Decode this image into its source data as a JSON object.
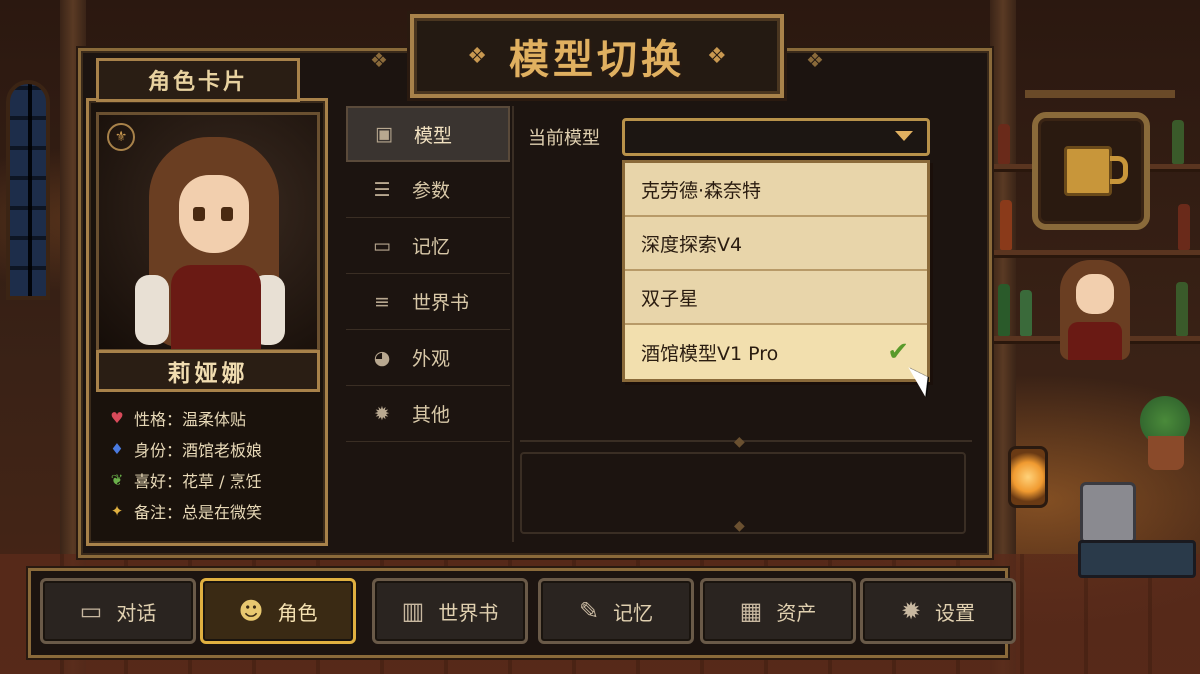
{
  "app": {
    "title": "模型切换"
  },
  "card": {
    "title": "角色卡片",
    "name": "莉娅娜",
    "traits": [
      {
        "icon": "heart-icon",
        "glyph": "♥",
        "color": "#d84a5a",
        "text": "性格：温柔体贴"
      },
      {
        "icon": "gem-icon",
        "glyph": "♦",
        "color": "#4a7ae0",
        "text": "身份：酒馆老板娘"
      },
      {
        "icon": "leaf-icon",
        "glyph": "❦",
        "color": "#6ab04a",
        "text": "喜好：花草 / 烹饪"
      },
      {
        "icon": "star-icon",
        "glyph": "✦",
        "color": "#e0b040",
        "text": "备注：总是在微笑"
      }
    ]
  },
  "nav": {
    "items": [
      {
        "label": "模型",
        "icon": "chip-icon",
        "glyph": "▣",
        "active": true
      },
      {
        "label": "参数",
        "icon": "sliders-icon",
        "glyph": "☰",
        "active": false
      },
      {
        "label": "记忆",
        "icon": "chat-bubble-icon",
        "glyph": "▭",
        "active": false
      },
      {
        "label": "世界书",
        "icon": "database-icon",
        "glyph": "≡",
        "active": false
      },
      {
        "label": "外观",
        "icon": "palette-icon",
        "glyph": "◕",
        "active": false
      },
      {
        "label": "其他",
        "icon": "gear-icon",
        "glyph": "✹",
        "active": false
      }
    ]
  },
  "model_select": {
    "label": "当前模型",
    "value": "",
    "options": [
      {
        "label": "克劳德·森奈特",
        "selected": false
      },
      {
        "label": "深度探索V4",
        "selected": false
      },
      {
        "label": "双子星",
        "selected": false
      },
      {
        "label": "酒馆模型V1 Pro",
        "selected": true
      }
    ]
  },
  "tabs": [
    {
      "label": "对话",
      "icon": "chat-icon",
      "glyph": "▭",
      "active": false
    },
    {
      "label": "角色",
      "icon": "users-icon",
      "glyph": "☻",
      "active": true
    },
    {
      "label": "世界书",
      "icon": "book-icon",
      "glyph": "▥",
      "active": false
    },
    {
      "label": "记忆",
      "icon": "quill-icon",
      "glyph": "✎",
      "active": false
    },
    {
      "label": "资产",
      "icon": "chest-icon",
      "glyph": "▦",
      "active": false
    },
    {
      "label": "设置",
      "icon": "gear-icon",
      "glyph": "✹",
      "active": false
    }
  ],
  "colors": {
    "accent_gold": "#e0b060",
    "frame_gold": "#a8824a",
    "dropdown_bg": "#e8d5aa",
    "check_green": "#5a9a2a"
  }
}
